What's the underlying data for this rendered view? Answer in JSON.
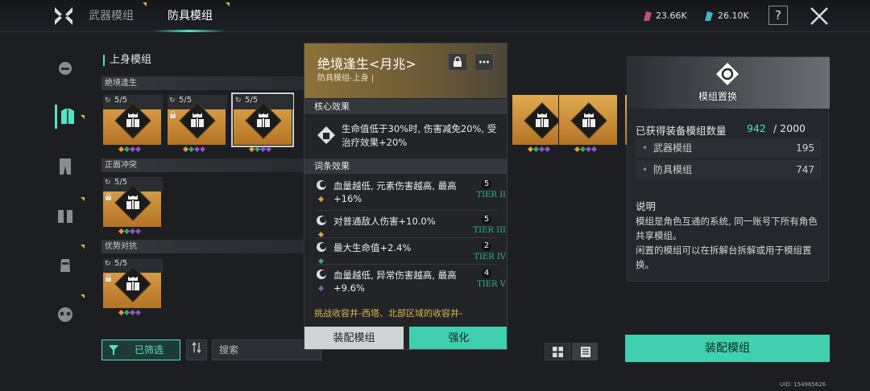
{
  "header": {
    "tabs": [
      {
        "label": "武器模组"
      },
      {
        "label": "防具模组"
      }
    ],
    "currency": [
      {
        "value": "23.66K",
        "color": "#c0546a"
      },
      {
        "value": "26.10K",
        "color": "#3fb7c7"
      }
    ],
    "help_label": "?"
  },
  "main": {
    "section_title": "上身模组",
    "groups": [
      {
        "name": "绝境逢生",
        "cards": [
          {
            "count": "5/5",
            "locked": false
          },
          {
            "count": "5/5",
            "locked": true
          },
          {
            "count": "5/5",
            "locked": false,
            "selected": true
          },
          {
            "count": "",
            "locked": false
          },
          {
            "count": "",
            "locked": false
          },
          {
            "count": "",
            "locked": false
          },
          {
            "count": "",
            "locked": false
          },
          {
            "count": "",
            "locked": false
          }
        ]
      },
      {
        "name": "正面冲突",
        "cards": [
          {
            "count": "5/5",
            "locked": true
          }
        ]
      },
      {
        "name": "优势对抗",
        "cards": [
          {
            "count": "5/5",
            "locked": true
          }
        ]
      }
    ],
    "filter_label": "已筛选",
    "search_placeholder": "搜索"
  },
  "popup": {
    "title": "绝境逢生<月兆>",
    "subtitle": "防具模组-上身 |",
    "core_header": "核心效果",
    "core_text": "生命值低于30%时, 伤害减免20%, 受治疗效果+20%",
    "affix_header": "词条效果",
    "affixes": [
      {
        "text": "血量越低, 元素伤害越高, 最高+16%",
        "level": "5",
        "tier": "TIER II",
        "gem_color": "#d9a13a"
      },
      {
        "text": "对普通敌人伤害+10.0%",
        "level": "5",
        "tier": "TIER III",
        "gem_color": "#d9a13a"
      },
      {
        "text": "最大生命值+2.4%",
        "level": "2",
        "tier": "TIER IV",
        "gem_color": "#3fa36a"
      },
      {
        "text": "血量越低, 异常伤害越高, 最高+9.6%",
        "level": "4",
        "tier": "TIER V",
        "gem_color": "#8a56c8"
      }
    ],
    "source_text": "挑战收容井-西塔、北部区域的收容井-",
    "equip_label": "装配模组",
    "enhance_label": "强化"
  },
  "right_panel": {
    "image_title": "模组置换",
    "count_label": "已获得装备模组数量",
    "count_current": "942",
    "count_total": "/ 2000",
    "rows": [
      {
        "label": "武器模组",
        "value": "195"
      },
      {
        "label": "防具模组",
        "value": "747"
      }
    ],
    "desc_title": "说明",
    "desc_text": "模组是角色互通的系统, 同一账号下所有角色共享模组。\n闲置的模组可以在拆解台拆解或用于模组置换。",
    "equip_label": "装配模组"
  },
  "uid": "UID: 154965626",
  "colors": {
    "accent": "#52e3c7",
    "gold": "#d9b84a",
    "card": "#d89a45"
  }
}
